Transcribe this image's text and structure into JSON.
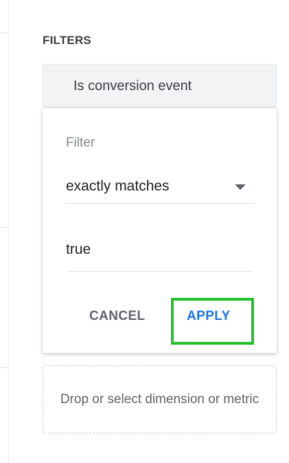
{
  "filters_panel": {
    "title": "FILTERS",
    "active_filter": {
      "dimension_label": "Is conversion event"
    },
    "editor": {
      "caption": "Filter",
      "match_type": {
        "selected": "exactly matches",
        "icon": "caret-down-icon"
      },
      "value": "true",
      "cancel_label": "CANCEL",
      "apply_label": "APPLY"
    },
    "dropzone_label": "Drop or select dimension or metric"
  },
  "colors": {
    "apply_text": "#1a73e8",
    "highlight_box": "#22c02a",
    "chip_background": "#f1f3f4"
  }
}
